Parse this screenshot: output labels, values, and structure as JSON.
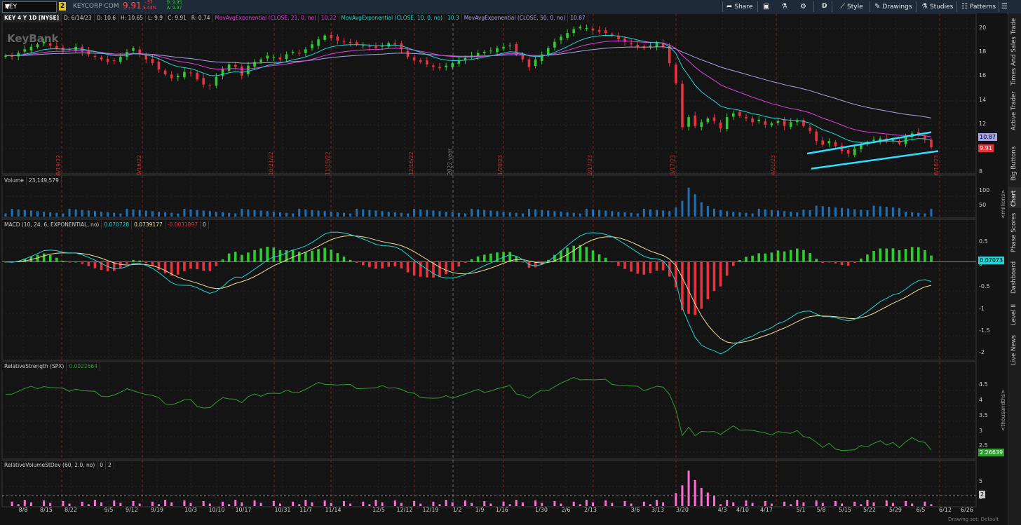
{
  "toolbar": {
    "symbol": "KEY",
    "link_number": "2",
    "company": "KEYCORP COM",
    "last": "9.91",
    "change": "-.57",
    "change_pct": "-5.44%",
    "bid": "B: 9.95",
    "ask": "A: 9.97",
    "share": "Share",
    "aggregation": "D",
    "style": "Style",
    "drawings": "Drawings",
    "studies": "Studies",
    "patterns": "Patterns"
  },
  "chart_header": {
    "title": "KEY 4 Y 1D [NYSE]",
    "date": "D: 6/14/23",
    "open": "O: 10.6",
    "high": "H: 10.65",
    "low": "L: 9.9",
    "close": "C: 9.91",
    "range": "R: 0.74",
    "ema21_label": "MovAvgExponential (CLOSE, 21, 0, no)",
    "ema21_value": "10.22",
    "ema10_label": "MovAvgExponential (CLOSE, 10, 0, no)",
    "ema10_value": "10.3",
    "ema50_label": "MovAvgExponential (CLOSE, 50, 0, no)",
    "ema50_value": "10.87"
  },
  "watermark": "KeyBank",
  "year_marker": "2022 year",
  "price_axis": [
    "20",
    "18",
    "16",
    "14",
    "12",
    "10",
    "8"
  ],
  "price_tags": [
    "10.87",
    "9.91"
  ],
  "volume_panel": {
    "label": "Volume",
    "value": "23,149,579",
    "ticks": [
      "100",
      "50"
    ],
    "unit": "<millions>"
  },
  "macd_panel": {
    "label": "MACD (10, 24, 6, EXPONENTIAL, no)",
    "value": "0.070728",
    "avg": "0.0739177",
    "diff": "-0.0031897",
    "zero": "0",
    "ticks": [
      "0.5",
      "0",
      "-0.5",
      "-1",
      "-1.5",
      "-2"
    ],
    "tag": "0.07073"
  },
  "rs_panel": {
    "label": "RelativeStrength (SPX)",
    "value": "0.0022664",
    "ticks": [
      "4.5",
      "4",
      "3.5",
      "3",
      "2.5"
    ],
    "unit": "<thousandths>",
    "tag": "2.26639"
  },
  "rvsd_panel": {
    "label": "RelativeVolumeStDev (60, 2.0, no)",
    "v1": "0",
    "v2": "2",
    "ticks": [
      "5",
      "0"
    ],
    "tag": "2"
  },
  "earnings_notes": [
    "8/19/22",
    "9/16/22",
    "10/21/22",
    "11/18/22",
    "12/16/22",
    "1/20/23",
    "2/17/23",
    "3/17/23",
    "4/21/23",
    "6/16/23"
  ],
  "date_axis": [
    "8/8",
    "8/15",
    "8/22",
    "9/5",
    "9/12",
    "9/19",
    "10/3",
    "10/10",
    "10/17",
    "10/31",
    "11/7",
    "11/14",
    "12/5",
    "12/12",
    "12/19",
    "1/2",
    "1/9",
    "1/16",
    "1/30",
    "2/6",
    "2/13",
    "3/6",
    "3/13",
    "3/20",
    "4/3",
    "4/10",
    "4/17",
    "5/1",
    "5/8",
    "5/15",
    "5/22",
    "5/29",
    "6/5",
    "6/12",
    "6/26"
  ],
  "footer_note": "Drawing set: Default",
  "sidebar_tabs": [
    "Trade",
    "Times And Sales",
    "Active Trader",
    "Big Buttons",
    "Chart",
    "Phase Scores",
    "Dashboard",
    "Level II",
    "Live News"
  ],
  "colors": {
    "up": "#2ecc2e",
    "down": "#e8323c",
    "ema10": "#22d3d3",
    "ema21": "#e040e0",
    "ema50": "#a5a5e8",
    "rs": "#2e9e2e",
    "rvsd": "#ff6ad5",
    "volume": "#1f6fb5",
    "channel": "#2ee0ff"
  },
  "chart_data": {
    "type": "candlestick",
    "price_ylim": [
      8,
      20
    ],
    "closes": [
      17.3,
      17.2,
      17.5,
      17.8,
      18.0,
      18.2,
      18.4,
      18.1,
      17.9,
      17.7,
      17.8,
      18.0,
      17.6,
      17.4,
      17.2,
      17.0,
      16.8,
      16.9,
      17.2,
      17.6,
      17.9,
      17.4,
      17.0,
      16.7,
      16.2,
      15.8,
      15.5,
      15.7,
      16.0,
      15.9,
      15.4,
      15.0,
      14.9,
      15.6,
      16.2,
      16.6,
      16.4,
      15.7,
      16.5,
      16.8,
      17.0,
      17.3,
      17.2,
      17.0,
      17.4,
      17.6,
      17.5,
      17.8,
      18.2,
      18.6,
      18.9,
      18.7,
      18.5,
      18.4,
      18.3,
      18.2,
      18.1,
      18.0,
      17.9,
      18.1,
      18.3,
      18.2,
      17.8,
      17.2,
      16.9,
      16.8,
      16.6,
      16.4,
      16.3,
      16.5,
      16.7,
      16.9,
      17.1,
      17.3,
      17.5,
      17.6,
      17.7,
      17.9,
      18.0,
      18.1,
      17.4,
      17.0,
      16.4,
      17.0,
      17.4,
      17.9,
      18.4,
      18.8,
      19.1,
      19.4,
      19.6,
      19.5,
      19.3,
      19.2,
      19.1,
      18.9,
      18.6,
      18.4,
      18.2,
      18.0,
      17.9,
      18.1,
      18.3,
      18.0,
      16.7,
      15.1,
      11.6,
      12.4,
      11.7,
      12.0,
      12.3,
      12.1,
      11.5,
      12.4,
      12.7,
      12.5,
      12.3,
      12.0,
      12.2,
      11.8,
      11.9,
      12.1,
      11.7,
      12.0,
      12.1,
      11.7,
      11.3,
      10.5,
      10.2,
      10.5,
      10.1,
      9.7,
      9.5,
      9.9,
      10.2,
      10.4,
      10.6,
      10.7,
      10.5,
      10.6,
      10.3,
      10.8,
      11.1,
      11.0,
      10.6,
      10.0
    ],
    "ema10_last": 10.3,
    "ema21_last": 10.22,
    "ema50_last": 10.87,
    "volume_last": 23149579,
    "macd": {
      "value": 0.070728,
      "avg": 0.0739177,
      "diff": -0.0031897,
      "ylim": [
        -2.1,
        0.7
      ]
    },
    "relative_strength_last": 2.26639,
    "rs_ylim": [
      2.2,
      5.0
    ]
  }
}
